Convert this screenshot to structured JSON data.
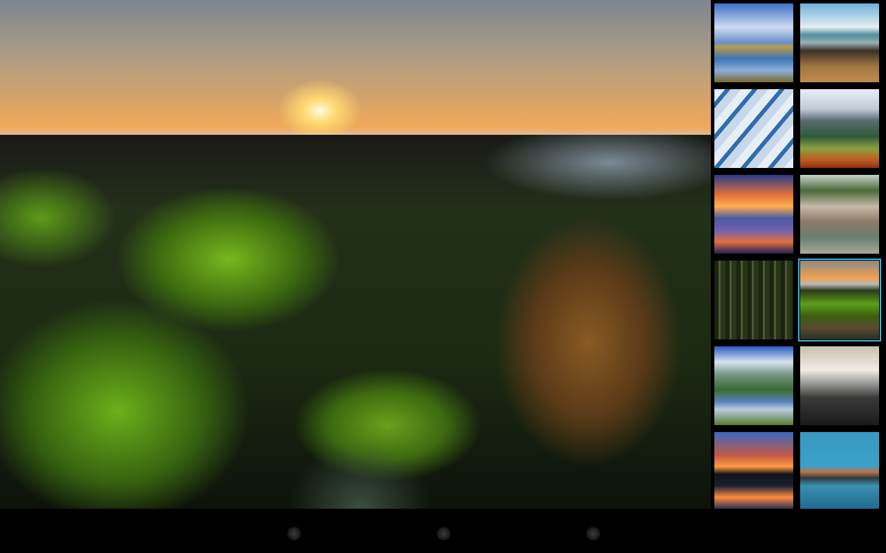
{
  "preview": {
    "image": "mossy-rocks-sunset-coast"
  },
  "thumbnails": [
    {
      "image": "sky-clouds-lake",
      "selected": false
    },
    {
      "image": "beach-rocks-sea",
      "selected": false
    },
    {
      "image": "clouds-aerial",
      "selected": false
    },
    {
      "image": "mountain-valley-autumn",
      "selected": false
    },
    {
      "image": "sunset-clouds-water",
      "selected": false
    },
    {
      "image": "canyon-river",
      "selected": false
    },
    {
      "image": "forest-path-sunlight",
      "selected": false
    },
    {
      "image": "mossy-rocks-sunset-coast",
      "selected": true
    },
    {
      "image": "mountain-lake-reflection",
      "selected": false
    },
    {
      "image": "city-aerial-clouds",
      "selected": false
    },
    {
      "image": "sunset-city-reflection",
      "selected": false
    },
    {
      "image": "waterfront-houses-dusk",
      "selected": false
    }
  ],
  "navbar": {
    "buttons": [
      "back-icon",
      "home-icon",
      "recent-apps-icon"
    ],
    "mode": "lights-out"
  },
  "colors": {
    "selection": "#33b5e5",
    "background": "#000000"
  }
}
